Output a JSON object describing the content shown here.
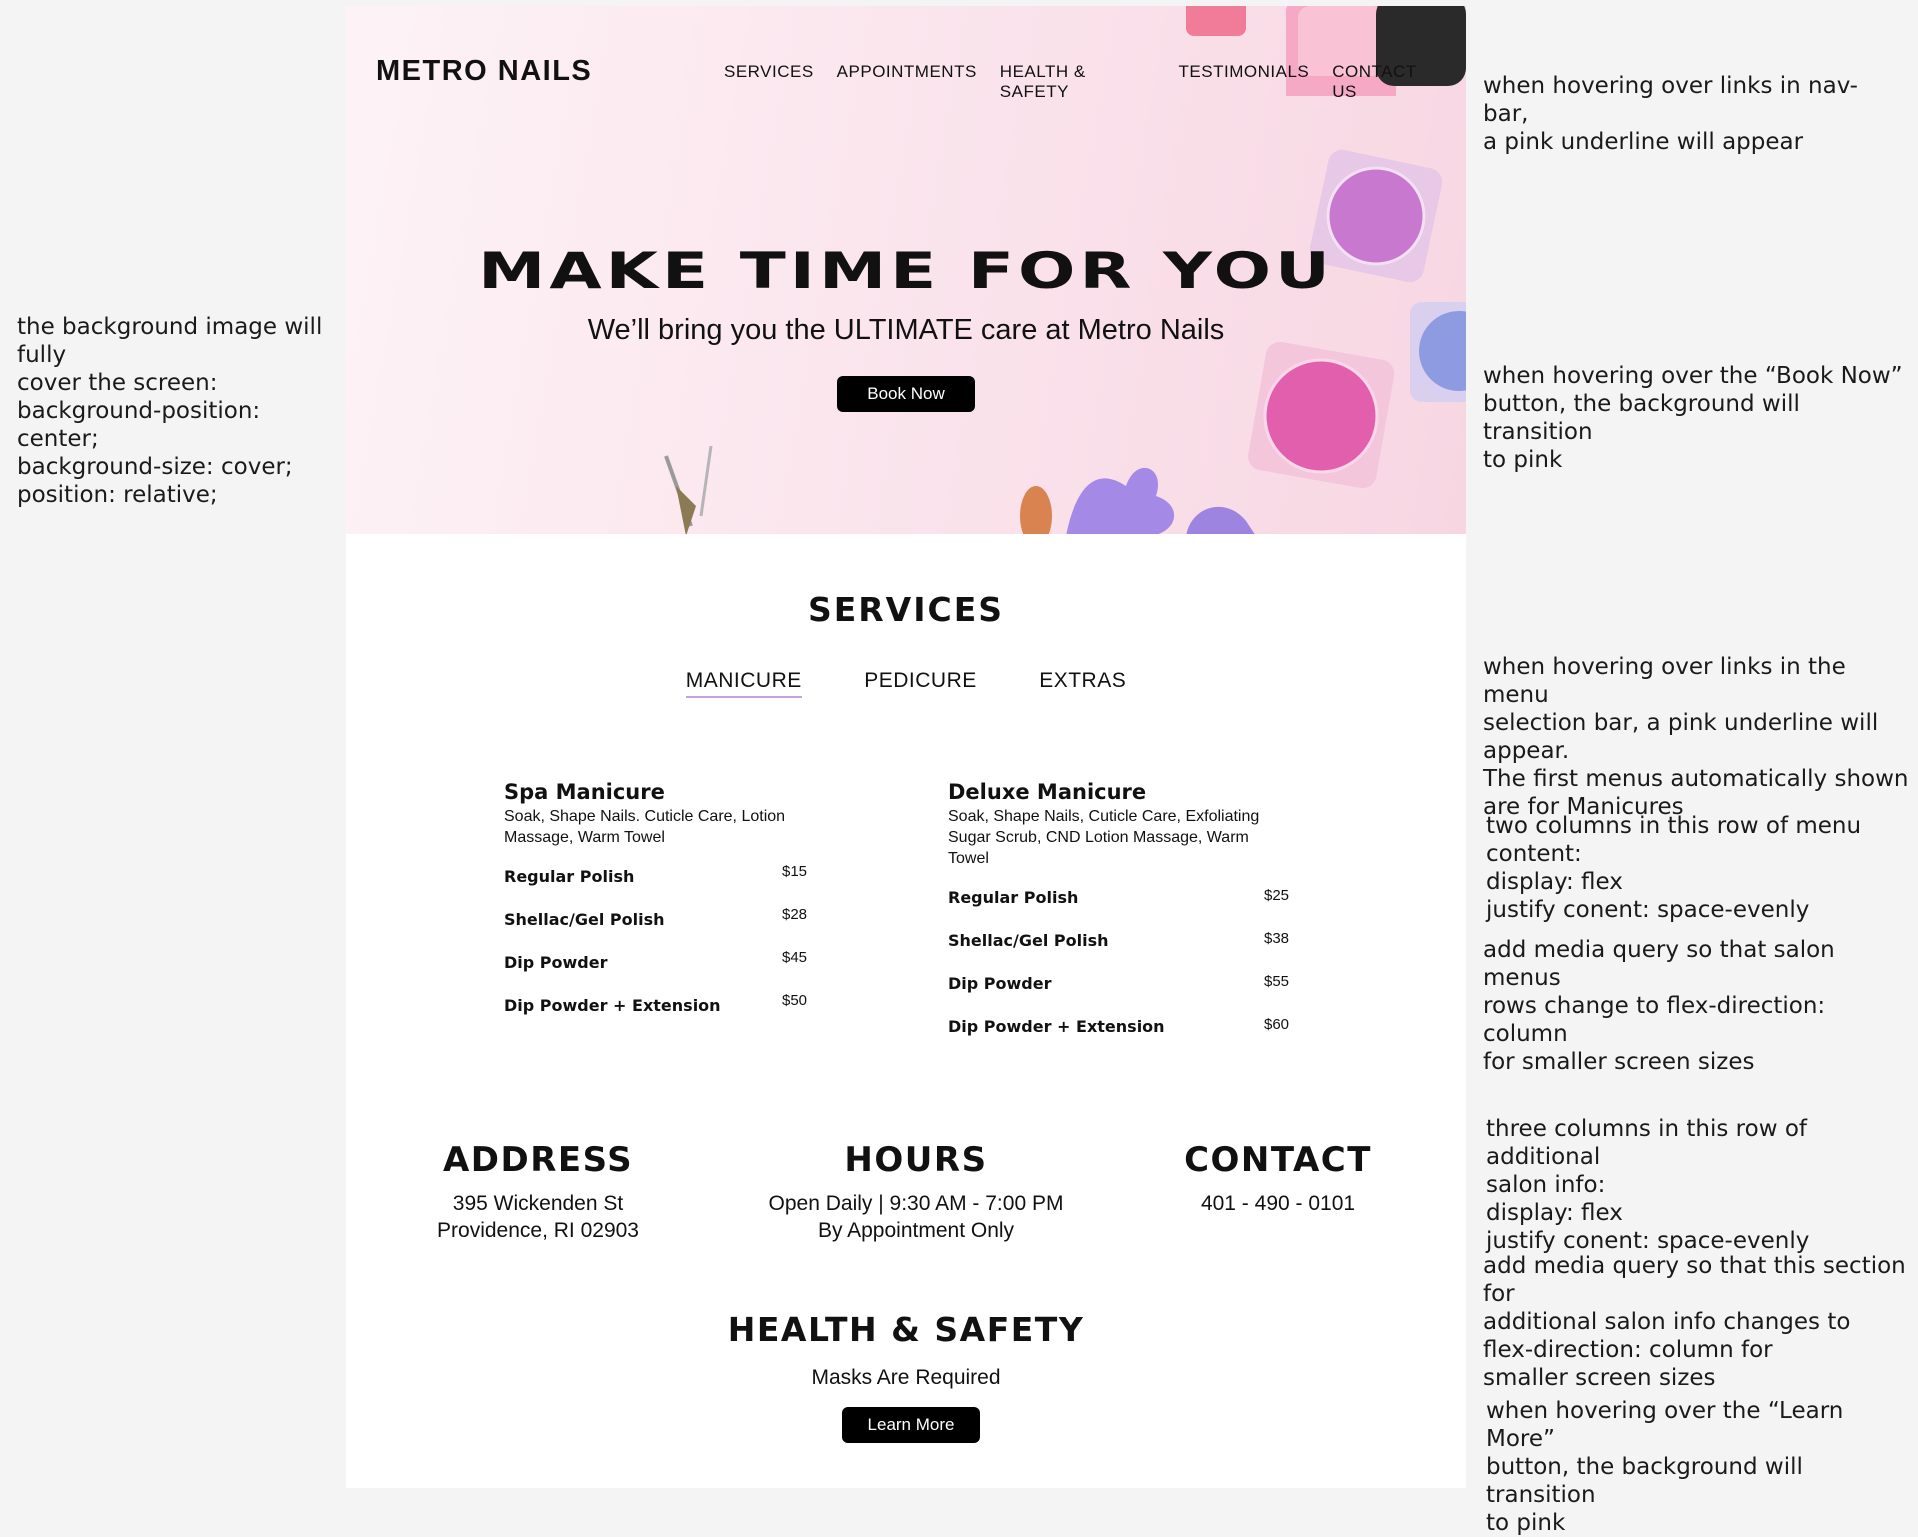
{
  "annotations": {
    "left_background": "the background image will fully\ncover the screen:\nbackground-position: center;\nbackground-size: cover;\nposition: relative;",
    "nav_hover": "when hovering over links in nav-bar,\na pink underline will appear",
    "book_hover": "when hovering over the “Book Now”\nbutton, the background will transition\nto pink",
    "menu_hover": "when hovering over links in the menu\nselection bar, a pink underline will appear.\nThe first menus automatically shown\nare for Manicures",
    "two_columns": "two columns in this row of menu content:\ndisplay: flex\njustify conent: space-evenly",
    "media_menus": "add media query so that salon menus\nrows change to flex-direction: column\nfor smaller screen sizes",
    "three_columns": "three columns in this row of additional\nsalon info:\ndisplay: flex\njustify conent: space-evenly",
    "media_info": "add media query so that this section for\nadditional salon info changes to\nflex-direction: column for\nsmaller screen sizes",
    "learn_hover": "when hovering over the “Learn More”\nbutton, the background will transition\nto pink"
  },
  "header": {
    "logo": "METRO NAILS",
    "nav": [
      "SERVICES",
      "APPOINTMENTS",
      "HEALTH & SAFETY",
      "TESTIMONIALS",
      "CONTACT US"
    ]
  },
  "hero": {
    "title": "MAKE TIME FOR YOU",
    "subtitle": "We’ll bring you the ULTIMATE care at Metro Nails",
    "button": "Book Now"
  },
  "services": {
    "title": "SERVICES",
    "tabs": [
      "MANICURE",
      "PEDICURE",
      "EXTRAS"
    ],
    "active_tab": "MANICURE",
    "menus": [
      {
        "name": "Spa Manicure",
        "description": "Soak, Shape Nails. Cuticle Care, Lotion Massage, Warm Towel",
        "items": [
          {
            "name": "Regular Polish",
            "price": "$15"
          },
          {
            "name": "Shellac/Gel Polish",
            "price": "$28"
          },
          {
            "name": "Dip Powder",
            "price": "$45"
          },
          {
            "name": "Dip Powder + Extension",
            "price": "$50"
          }
        ]
      },
      {
        "name": "Deluxe Manicure",
        "description": "Soak, Shape Nails, Cuticle Care, Exfoliating Sugar Scrub, CND Lotion Massage, Warm Towel",
        "items": [
          {
            "name": "Regular Polish",
            "price": "$25"
          },
          {
            "name": "Shellac/Gel Polish",
            "price": "$38"
          },
          {
            "name": "Dip Powder",
            "price": "$55"
          },
          {
            "name": "Dip Powder + Extension",
            "price": "$60"
          }
        ]
      }
    ]
  },
  "info": {
    "address": {
      "title": "ADDRESS",
      "line1": "395 Wickenden St",
      "line2": "Providence, RI 02903"
    },
    "hours": {
      "title": "HOURS",
      "line1": "Open Daily | 9:30 AM - 7:00 PM",
      "line2": "By Appointment Only"
    },
    "contact": {
      "title": "CONTACT",
      "line1": "401 - 490 - 0101"
    }
  },
  "health": {
    "title": "HEALTH & SAFETY",
    "text": "Masks Are Required",
    "button": "Learn More"
  },
  "colors": {
    "accent_pink": "#caa0d8",
    "button_bg": "#000000",
    "hero_bg": "#fbe6ee"
  }
}
